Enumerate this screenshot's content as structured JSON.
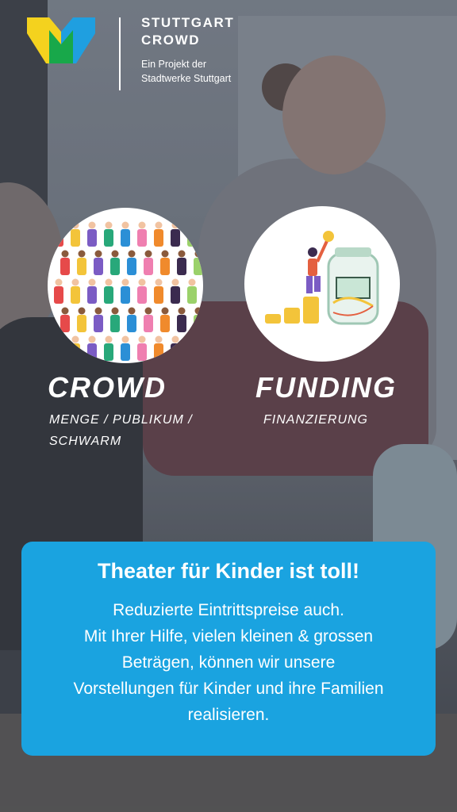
{
  "brand": {
    "title_line1": "STUTTGART",
    "title_line2": "CROWD",
    "subtitle_line1": "Ein Projekt der",
    "subtitle_line2": "Stadtwerke Stuttgart",
    "colors": {
      "yellow": "#f4d21e",
      "green": "#18a84a",
      "blue": "#1f9fe0"
    }
  },
  "crowd": {
    "heading": "CROWD",
    "caption_line1": "MENGE / PUBLIKUM /",
    "caption_line2": "SCHWARM",
    "icon": "crowd-illustration"
  },
  "funding": {
    "heading": "FUNDING",
    "caption": "FINANZIERUNG",
    "icon": "funding-illustration"
  },
  "card": {
    "headline": "Theater für Kinder ist toll!",
    "body_lines": [
      "Reduzierte Eintrittspreise auch.",
      "Mit Ihrer Hilfe, vielen kleinen & grossen",
      "Beträgen, können wir unsere",
      "Vorstellungen für Kinder und ihre Familien",
      "realisieren."
    ],
    "background": "#1aa3e0"
  }
}
